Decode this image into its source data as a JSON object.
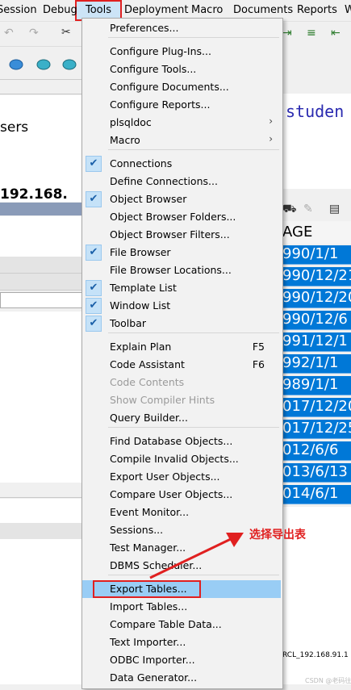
{
  "menubar": {
    "items": [
      "Session",
      "Debug",
      "Tools",
      "Deployment",
      "Macro",
      "Documents",
      "Reports",
      "W"
    ]
  },
  "left": {
    "users_text": "sers",
    "ip_text": "192.168."
  },
  "editor": {
    "text": "studen"
  },
  "grid": {
    "header": "AGE",
    "rows": [
      "990/1/1",
      "990/12/21",
      "990/12/20",
      "990/12/6",
      "991/12/1",
      "992/1/1",
      "989/1/1",
      "017/12/20",
      "017/12/25",
      "012/6/6",
      "013/6/13",
      "014/6/1"
    ]
  },
  "status": {
    "conn": "RCL_192.168.91.1"
  },
  "menu": {
    "items": [
      {
        "label": "Preferences...",
        "checked": false,
        "disabled": false,
        "submenu": false,
        "shortcut": ""
      },
      {
        "label": "Configure Plug-Ins...",
        "checked": false,
        "disabled": false,
        "submenu": false,
        "shortcut": ""
      },
      {
        "label": "Configure Tools...",
        "checked": false,
        "disabled": false,
        "submenu": false,
        "shortcut": ""
      },
      {
        "label": "Configure Documents...",
        "checked": false,
        "disabled": false,
        "submenu": false,
        "shortcut": ""
      },
      {
        "label": "Configure Reports...",
        "checked": false,
        "disabled": false,
        "submenu": false,
        "shortcut": ""
      },
      {
        "label": "plsqldoc",
        "checked": false,
        "disabled": false,
        "submenu": true,
        "shortcut": ""
      },
      {
        "label": "Macro",
        "checked": false,
        "disabled": false,
        "submenu": true,
        "shortcut": ""
      },
      {
        "label": "Connections",
        "checked": true,
        "disabled": false,
        "submenu": false,
        "shortcut": ""
      },
      {
        "label": "Define Connections...",
        "checked": false,
        "disabled": false,
        "submenu": false,
        "shortcut": ""
      },
      {
        "label": "Object Browser",
        "checked": true,
        "disabled": false,
        "submenu": false,
        "shortcut": ""
      },
      {
        "label": "Object Browser Folders...",
        "checked": false,
        "disabled": false,
        "submenu": false,
        "shortcut": ""
      },
      {
        "label": "Object Browser Filters...",
        "checked": false,
        "disabled": false,
        "submenu": false,
        "shortcut": ""
      },
      {
        "label": "File Browser",
        "checked": true,
        "disabled": false,
        "submenu": false,
        "shortcut": ""
      },
      {
        "label": "File Browser Locations...",
        "checked": false,
        "disabled": false,
        "submenu": false,
        "shortcut": ""
      },
      {
        "label": "Template List",
        "checked": true,
        "disabled": false,
        "submenu": false,
        "shortcut": ""
      },
      {
        "label": "Window List",
        "checked": true,
        "disabled": false,
        "submenu": false,
        "shortcut": ""
      },
      {
        "label": "Toolbar",
        "checked": true,
        "disabled": false,
        "submenu": false,
        "shortcut": ""
      },
      {
        "label": "Explain Plan",
        "checked": false,
        "disabled": false,
        "submenu": false,
        "shortcut": "F5"
      },
      {
        "label": "Code Assistant",
        "checked": false,
        "disabled": false,
        "submenu": false,
        "shortcut": "F6"
      },
      {
        "label": "Code Contents",
        "checked": false,
        "disabled": true,
        "submenu": false,
        "shortcut": ""
      },
      {
        "label": "Show Compiler Hints",
        "checked": false,
        "disabled": true,
        "submenu": false,
        "shortcut": ""
      },
      {
        "label": "Query Builder...",
        "checked": false,
        "disabled": false,
        "submenu": false,
        "shortcut": ""
      },
      {
        "label": "Find Database Objects...",
        "checked": false,
        "disabled": false,
        "submenu": false,
        "shortcut": ""
      },
      {
        "label": "Compile Invalid Objects...",
        "checked": false,
        "disabled": false,
        "submenu": false,
        "shortcut": ""
      },
      {
        "label": "Export User Objects...",
        "checked": false,
        "disabled": false,
        "submenu": false,
        "shortcut": ""
      },
      {
        "label": "Compare User Objects...",
        "checked": false,
        "disabled": false,
        "submenu": false,
        "shortcut": ""
      },
      {
        "label": "Event Monitor...",
        "checked": false,
        "disabled": false,
        "submenu": false,
        "shortcut": ""
      },
      {
        "label": "Sessions...",
        "checked": false,
        "disabled": false,
        "submenu": false,
        "shortcut": ""
      },
      {
        "label": "Test Manager...",
        "checked": false,
        "disabled": false,
        "submenu": false,
        "shortcut": ""
      },
      {
        "label": "DBMS Scheduler...",
        "checked": false,
        "disabled": false,
        "submenu": false,
        "shortcut": ""
      },
      {
        "label": "Export Tables...",
        "checked": false,
        "disabled": false,
        "submenu": false,
        "shortcut": "",
        "highlighted": true
      },
      {
        "label": "Import Tables...",
        "checked": false,
        "disabled": false,
        "submenu": false,
        "shortcut": ""
      },
      {
        "label": "Compare Table Data...",
        "checked": false,
        "disabled": false,
        "submenu": false,
        "shortcut": ""
      },
      {
        "label": "Text Importer...",
        "checked": false,
        "disabled": false,
        "submenu": false,
        "shortcut": ""
      },
      {
        "label": "ODBC Importer...",
        "checked": false,
        "disabled": false,
        "submenu": false,
        "shortcut": ""
      },
      {
        "label": "Data Generator...",
        "checked": false,
        "disabled": false,
        "submenu": false,
        "shortcut": ""
      }
    ]
  },
  "annotation": {
    "text": "选择导出表",
    "color": "#e02020"
  },
  "watermark": "CSDN @老码往造"
}
